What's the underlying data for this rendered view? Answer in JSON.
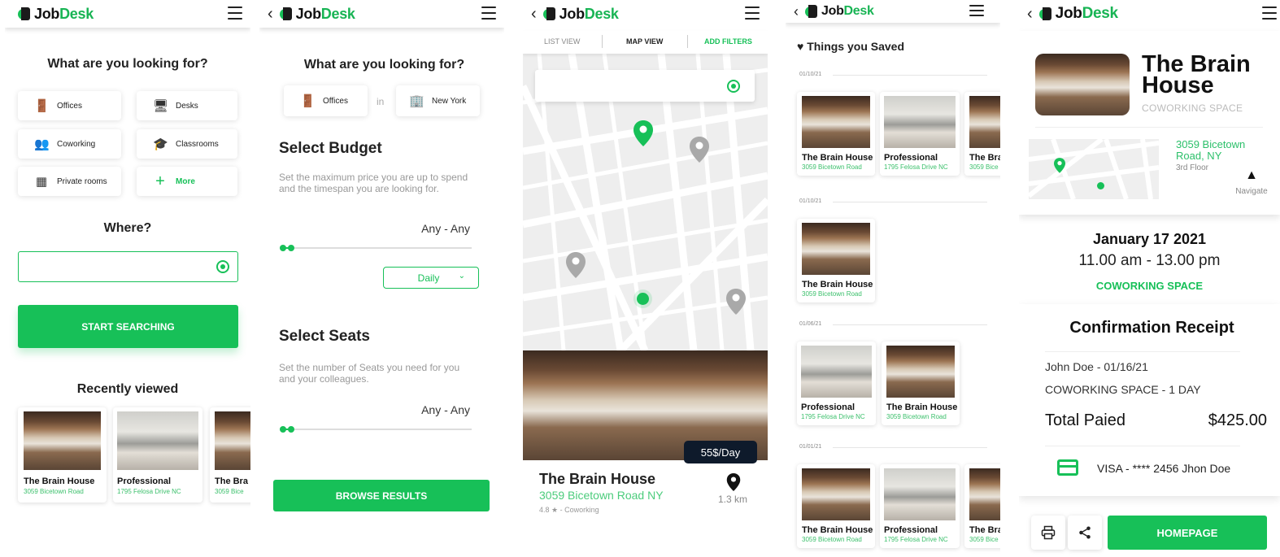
{
  "brand": {
    "name_dark": "Job",
    "name_green": "Desk",
    "green": "#17c058"
  },
  "s1": {
    "question": "What are you looking for?",
    "categories": [
      {
        "label": "Offices",
        "icon": "door-icon"
      },
      {
        "label": "Desks",
        "icon": "desk-icon"
      },
      {
        "label": "Coworking",
        "icon": "people-icon"
      },
      {
        "label": "Classrooms",
        "icon": "graduation-cap-icon"
      },
      {
        "label": "Private rooms",
        "icon": "room-icon"
      },
      {
        "label": "More",
        "icon": "plus-icon"
      }
    ],
    "where": "Where?",
    "where_value": "",
    "start": "START SEARCHING",
    "recent": "Recently viewed",
    "recent_items": [
      {
        "name": "The Brain House",
        "addr": "3059 Bicetown Road"
      },
      {
        "name": "Professional",
        "addr": "1795 Felosa Drive NC"
      },
      {
        "name": "The Bra",
        "addr": "3059 Bice"
      }
    ]
  },
  "s2": {
    "question": "What are you looking for?",
    "type": "Offices",
    "in": "in",
    "city": "New York",
    "budget_title": "Select Budget",
    "budget_desc": "Set the maximum price you are up to spend and the timespan you are looking for.",
    "budget_range": "Any - Any",
    "period": "Daily",
    "seats_title": "Select Seats",
    "seats_desc": "Set the number of Seats you need for you and your colleagues.",
    "seats_range": "Any - Any",
    "browse": "BROWSE RESULTS"
  },
  "s3": {
    "tabs": [
      "LIST VIEW",
      "MAP VIEW",
      "ADD FILTERS"
    ],
    "search_value": "",
    "price": "55$/Day",
    "name": "The Brain House",
    "addr": "3059 Bicetown Road NY",
    "rating": "4.8",
    "kind": "- Coworking",
    "distance": "1.3 km"
  },
  "s4": {
    "title": "Things you Saved",
    "groups": [
      {
        "date": "01/10/21",
        "items": [
          {
            "name": "The Brain House",
            "addr": "3059 Bicetown Road"
          },
          {
            "name": "Professional",
            "addr": "1795 Felosa Drive NC"
          },
          {
            "name": "The Bra",
            "addr": "3059 Bice"
          }
        ]
      },
      {
        "date": "01/10/21",
        "items": [
          {
            "name": "The Brain House",
            "addr": "3059 Bicetown Road"
          }
        ]
      },
      {
        "date": "01/06/21",
        "items": [
          {
            "name": "Professional",
            "addr": "1795 Felosa Drive NC"
          },
          {
            "name": "The Brain House",
            "addr": "3059 Bicetown Road"
          }
        ]
      },
      {
        "date": "01/01/21",
        "items": [
          {
            "name": "The Brain House",
            "addr": "3059 Bicetown Road"
          },
          {
            "name": "Professional",
            "addr": "1795 Felosa Drive NC"
          },
          {
            "name": "The Bra",
            "addr": "3059 Bice"
          }
        ]
      }
    ]
  },
  "s5": {
    "title_line1": "The Brain",
    "title_line2": "House",
    "subtitle": "COWORKING SPACE",
    "addr_line1": "3059 Bicetown",
    "addr_line2": "Road, NY",
    "floor": "3rd Floor",
    "navigate": "Navigate",
    "date": "January 17 2021",
    "time": "11.00 am - 13.00 pm",
    "space": "COWORKING SPACE",
    "receipt": "Confirmation Receipt",
    "line1": "John Doe - 01/16/21",
    "line2": "COWORKING SPACE - 1 DAY",
    "total_label": "Total Paied",
    "total_value": "$425.00",
    "card": "VISA - **** 2456 Jhon Doe",
    "home": "HOMEPAGE"
  }
}
